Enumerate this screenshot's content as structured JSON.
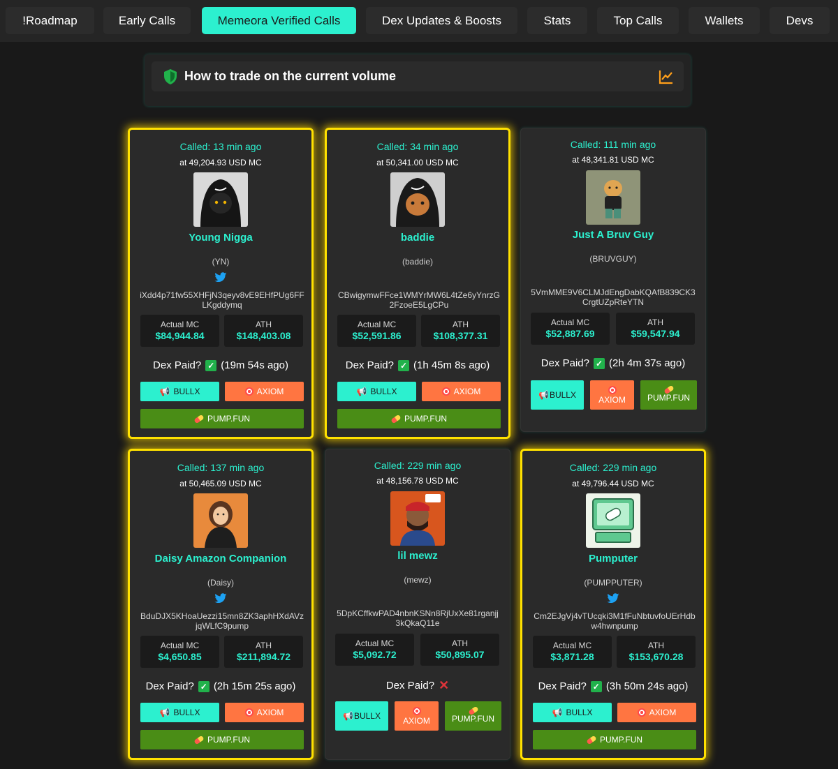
{
  "nav": [
    {
      "label": "!Roadmap",
      "active": false
    },
    {
      "label": "Early Calls",
      "active": false
    },
    {
      "label": "Memeora Verified Calls",
      "active": true
    },
    {
      "label": "Dex Updates & Boosts",
      "active": false
    },
    {
      "label": "Stats",
      "active": false
    },
    {
      "label": "Top Calls",
      "active": false
    },
    {
      "label": "Wallets",
      "active": false
    },
    {
      "label": "Devs",
      "active": false
    }
  ],
  "howto": {
    "title": "How to trade on the current volume",
    "icons": [
      "shield-icon",
      "chart-line-icon"
    ]
  },
  "colors": {
    "accent": "#2cf0cf",
    "glow": "#ffe100",
    "axiom": "#ff7541",
    "pump": "#4a8d16",
    "check": "#21b14b",
    "cross": "#e0343a"
  },
  "labels": {
    "actual_mc": "Actual MC",
    "ath": "ATH",
    "dex_paid": "Dex Paid?",
    "bullx": "BULLX",
    "axiom": "AXIOM",
    "pump": "PUMP.FUN"
  },
  "cards": [
    {
      "called": "Called: 13 min ago",
      "mc_at": "at 49,204.93 USD MC",
      "name": "Young Nigga",
      "ticker": "(YN)",
      "twitter": true,
      "address": "iXdd4p71fw55XHFjN3qeyv8vE9EHfPUg6FFLKgddymq",
      "actual_mc": "$84,944.84",
      "ath": "$148,403.08",
      "dex_paid": true,
      "dex_ago": "(19m 54s ago)",
      "highlighted": true
    },
    {
      "called": "Called: 34 min ago",
      "mc_at": "at 50,341.00 USD MC",
      "name": "baddie",
      "ticker": "(baddie)",
      "twitter": false,
      "address": "CBwigymwFFce1WMYrMW6L4tZe6yYnrzG2FzoeE5LgCPu",
      "actual_mc": "$52,591.86",
      "ath": "$108,377.31",
      "dex_paid": true,
      "dex_ago": "(1h 45m 8s ago)",
      "highlighted": true
    },
    {
      "called": "Called: 111 min ago",
      "mc_at": "at 48,341.81 USD MC",
      "name": "Just A Bruv Guy",
      "ticker": "(BRUVGUY)",
      "twitter": false,
      "address": "5VmMME9V6CLMJdEngDabKQAfB839CK3CrgtUZpRteYTN",
      "actual_mc": "$52,887.69",
      "ath": "$59,547.94",
      "dex_paid": true,
      "dex_ago": "(2h 4m 37s ago)",
      "highlighted": false
    },
    {
      "called": "Called: 137 min ago",
      "mc_at": "at 50,465.09 USD MC",
      "name": "Daisy Amazon Companion",
      "ticker": "(Daisy)",
      "twitter": true,
      "address": "BduDJX5KHoaUezzi15mn8ZK3aphHXdAVzjqWLfC9pump",
      "actual_mc": "$4,650.85",
      "ath": "$211,894.72",
      "dex_paid": true,
      "dex_ago": "(2h 15m 25s ago)",
      "highlighted": true
    },
    {
      "called": "Called: 229 min ago",
      "mc_at": "at 48,156.78 USD MC",
      "name": "lil mewz",
      "ticker": "(mewz)",
      "twitter": false,
      "address": "5DpKCffkwPAD4nbnKSNn8RjUxXe81rganjj3kQkaQ11e",
      "actual_mc": "$5,092.72",
      "ath": "$50,895.07",
      "dex_paid": false,
      "dex_ago": "",
      "highlighted": false
    },
    {
      "called": "Called: 229 min ago",
      "mc_at": "at 49,796.44 USD MC",
      "name": "Pumputer",
      "ticker": "(PUMPPUTER)",
      "twitter": true,
      "address": "Cm2EJgVj4vTUcqki3M1fFuNbtuvfoUErHdbw4hwnpump",
      "actual_mc": "$3,871.28",
      "ath": "$153,670.28",
      "dex_paid": true,
      "dex_ago": "(3h 50m 24s ago)",
      "highlighted": true
    }
  ]
}
